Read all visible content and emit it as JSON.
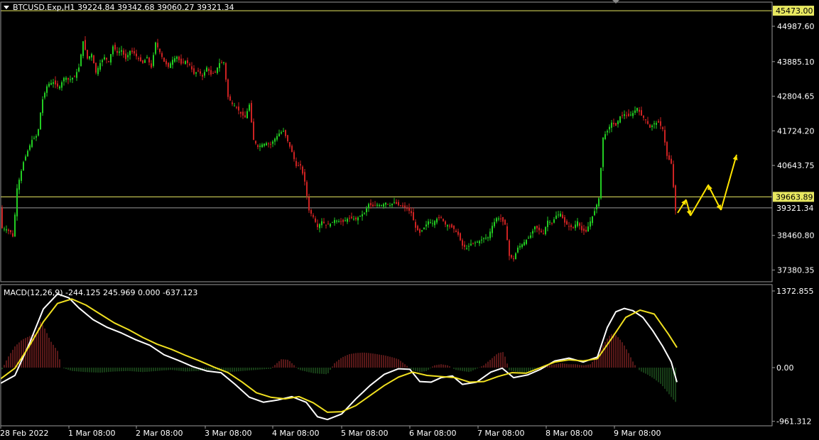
{
  "header": {
    "symbol_line": "BTCUSD.Exp,H1  39224.84 39342.68 39060.27 39321.34",
    "macd_line": "MACD(12,26,9) -244.125 245.969 0.000 -637.123"
  },
  "colors": {
    "background": "#000000",
    "bull": "#22cc22",
    "bear": "#cc2222",
    "hline": "#e8e860",
    "price_line": "#9a9a9a",
    "macd_main": "#ffffff",
    "macd_signal": "#f0e020",
    "hist_pos": "#b03030",
    "hist_neg": "#2e7a2e",
    "arrow": "#ffe400",
    "grid_border": "#9a9a9a"
  },
  "chart_data": [
    {
      "type": "candlestick",
      "title": "BTCUSD.Exp,H1",
      "price_axis_ticks": [
        "44987.60",
        "43885.10",
        "42804.65",
        "41724.20",
        "40643.75",
        "39663.89",
        "38460.80",
        "37380.35"
      ],
      "price_axis_values": [
        44987.6,
        43885.1,
        42804.65,
        41724.2,
        40643.75,
        39663.89,
        38460.8,
        37380.35
      ],
      "ylim": [
        37060,
        45600
      ],
      "time_axis_labels": [
        "28 Feb 2022",
        "1 Mar 08:00",
        "2 Mar 08:00",
        "3 Mar 08:00",
        "4 Mar 08:00",
        "5 Mar 08:00",
        "6 Mar 08:00",
        "7 Mar 08:00",
        "8 Mar 08:00",
        "9 Mar 08:00"
      ],
      "last_ohlc": {
        "open": 39224.84,
        "high": 39342.68,
        "low": 39060.27,
        "close": 39321.34
      },
      "horizontal_lines": [
        {
          "value": 45473.0,
          "label": "45473.00"
        },
        {
          "value": 39663.89,
          "label": "39663.89"
        }
      ],
      "current_price": {
        "value": 39321.34,
        "label": "39321.34"
      },
      "close_path": [
        [
          0,
          38700
        ],
        [
          8,
          38650
        ],
        [
          14,
          38560
        ],
        [
          18,
          38380
        ],
        [
          22,
          39840
        ],
        [
          28,
          40380
        ],
        [
          32,
          40750
        ],
        [
          38,
          41100
        ],
        [
          44,
          41440
        ],
        [
          52,
          41600
        ],
        [
          58,
          42640
        ],
        [
          66,
          43180
        ],
        [
          74,
          43240
        ],
        [
          82,
          43060
        ],
        [
          90,
          43420
        ],
        [
          96,
          43300
        ],
        [
          104,
          43420
        ],
        [
          110,
          43700
        ],
        [
          116,
          44520
        ],
        [
          122,
          43980
        ],
        [
          128,
          44120
        ],
        [
          134,
          43540
        ],
        [
          140,
          43840
        ],
        [
          146,
          44020
        ],
        [
          152,
          43880
        ],
        [
          158,
          44360
        ],
        [
          164,
          44160
        ],
        [
          170,
          44240
        ],
        [
          176,
          43960
        ],
        [
          182,
          44220
        ],
        [
          188,
          44140
        ],
        [
          194,
          43960
        ],
        [
          200,
          43840
        ],
        [
          206,
          44020
        ],
        [
          212,
          43700
        ],
        [
          218,
          44480
        ],
        [
          224,
          44180
        ],
        [
          230,
          43880
        ],
        [
          236,
          43720
        ],
        [
          242,
          43940
        ],
        [
          248,
          44040
        ],
        [
          254,
          43820
        ],
        [
          260,
          43900
        ],
        [
          266,
          43780
        ],
        [
          272,
          43500
        ],
        [
          278,
          43600
        ],
        [
          284,
          43420
        ],
        [
          290,
          43700
        ],
        [
          296,
          43480
        ],
        [
          302,
          43560
        ],
        [
          308,
          43840
        ],
        [
          314,
          43860
        ],
        [
          320,
          42780
        ],
        [
          326,
          42560
        ],
        [
          332,
          42460
        ],
        [
          338,
          42260
        ],
        [
          344,
          42140
        ],
        [
          350,
          42540
        ],
        [
          356,
          41440
        ],
        [
          362,
          41220
        ],
        [
          368,
          41300
        ],
        [
          374,
          41340
        ],
        [
          380,
          41300
        ],
        [
          386,
          41480
        ],
        [
          392,
          41640
        ],
        [
          398,
          41720
        ],
        [
          404,
          41400
        ],
        [
          410,
          41060
        ],
        [
          416,
          40620
        ],
        [
          422,
          40640
        ],
        [
          428,
          40140
        ],
        [
          434,
          39240
        ],
        [
          440,
          39040
        ],
        [
          446,
          38720
        ],
        [
          452,
          38900
        ],
        [
          458,
          38780
        ],
        [
          464,
          38820
        ],
        [
          470,
          38940
        ],
        [
          476,
          38900
        ],
        [
          482,
          38880
        ],
        [
          488,
          38980
        ],
        [
          494,
          39000
        ],
        [
          500,
          38960
        ],
        [
          506,
          39080
        ],
        [
          512,
          39160
        ],
        [
          518,
          39440
        ],
        [
          524,
          39360
        ],
        [
          530,
          39420
        ],
        [
          536,
          39400
        ],
        [
          542,
          39480
        ],
        [
          548,
          39400
        ],
        [
          554,
          39500
        ],
        [
          560,
          39400
        ],
        [
          566,
          39360
        ],
        [
          572,
          39300
        ],
        [
          578,
          39160
        ],
        [
          584,
          38700
        ],
        [
          590,
          38540
        ],
        [
          596,
          38700
        ],
        [
          602,
          38900
        ],
        [
          608,
          38840
        ],
        [
          614,
          38980
        ],
        [
          620,
          39020
        ],
        [
          626,
          38800
        ],
        [
          632,
          38760
        ],
        [
          638,
          38660
        ],
        [
          644,
          38480
        ],
        [
          650,
          38140
        ],
        [
          656,
          38060
        ],
        [
          662,
          38200
        ],
        [
          668,
          38240
        ],
        [
          674,
          38280
        ],
        [
          680,
          38380
        ],
        [
          686,
          38400
        ],
        [
          692,
          38760
        ],
        [
          698,
          39000
        ],
        [
          704,
          38980
        ],
        [
          710,
          38800
        ],
        [
          716,
          37820
        ],
        [
          722,
          37720
        ],
        [
          728,
          38080
        ],
        [
          734,
          38180
        ],
        [
          740,
          38320
        ],
        [
          746,
          38460
        ],
        [
          752,
          38740
        ],
        [
          758,
          38620
        ],
        [
          764,
          38520
        ],
        [
          770,
          38920
        ],
        [
          776,
          38840
        ],
        [
          782,
          39080
        ],
        [
          788,
          39140
        ],
        [
          794,
          38860
        ],
        [
          800,
          38740
        ],
        [
          806,
          38700
        ],
        [
          812,
          38900
        ],
        [
          818,
          38620
        ],
        [
          824,
          38580
        ],
        [
          830,
          38900
        ],
        [
          836,
          39220
        ],
        [
          842,
          39620
        ],
        [
          848,
          41520
        ],
        [
          854,
          41720
        ],
        [
          860,
          41980
        ],
        [
          866,
          41880
        ],
        [
          872,
          42180
        ],
        [
          878,
          42240
        ],
        [
          884,
          42180
        ],
        [
          890,
          42280
        ],
        [
          896,
          42440
        ],
        [
          902,
          42200
        ],
        [
          908,
          42060
        ],
        [
          914,
          41820
        ],
        [
          920,
          41960
        ],
        [
          926,
          41980
        ],
        [
          932,
          41780
        ],
        [
          938,
          40940
        ],
        [
          944,
          40700
        ],
        [
          950,
          39240
        ],
        [
          952,
          39321
        ]
      ]
    },
    {
      "type": "line",
      "title": "MACD(12,26,9)",
      "ylim": [
        -1030,
        1430
      ],
      "ticks": [
        "1372.855",
        "0.00",
        "-961.312"
      ],
      "tick_values": [
        1372.855,
        0.0,
        -961.312
      ],
      "main_value": -244.125,
      "signal_value": 245.969,
      "main": [
        [
          0,
          -280
        ],
        [
          20,
          -140
        ],
        [
          40,
          420
        ],
        [
          60,
          1050
        ],
        [
          80,
          1320
        ],
        [
          96,
          1250
        ],
        [
          110,
          1070
        ],
        [
          130,
          860
        ],
        [
          150,
          720
        ],
        [
          170,
          620
        ],
        [
          190,
          500
        ],
        [
          210,
          400
        ],
        [
          230,
          230
        ],
        [
          250,
          130
        ],
        [
          270,
          20
        ],
        [
          290,
          -60
        ],
        [
          310,
          -90
        ],
        [
          330,
          -300
        ],
        [
          350,
          -530
        ],
        [
          370,
          -620
        ],
        [
          390,
          -580
        ],
        [
          410,
          -520
        ],
        [
          430,
          -620
        ],
        [
          446,
          -880
        ],
        [
          460,
          -930
        ],
        [
          480,
          -830
        ],
        [
          500,
          -560
        ],
        [
          520,
          -320
        ],
        [
          540,
          -120
        ],
        [
          560,
          -20
        ],
        [
          576,
          -30
        ],
        [
          590,
          -250
        ],
        [
          606,
          -260
        ],
        [
          620,
          -180
        ],
        [
          636,
          -150
        ],
        [
          650,
          -300
        ],
        [
          670,
          -260
        ],
        [
          690,
          -80
        ],
        [
          706,
          -10
        ],
        [
          722,
          -180
        ],
        [
          742,
          -130
        ],
        [
          760,
          -30
        ],
        [
          780,
          120
        ],
        [
          800,
          170
        ],
        [
          820,
          100
        ],
        [
          840,
          190
        ],
        [
          854,
          720
        ],
        [
          866,
          1000
        ],
        [
          878,
          1060
        ],
        [
          890,
          1020
        ],
        [
          904,
          900
        ],
        [
          918,
          660
        ],
        [
          932,
          380
        ],
        [
          944,
          100
        ],
        [
          952,
          -260
        ]
      ],
      "signal": [
        [
          0,
          -200
        ],
        [
          20,
          -10
        ],
        [
          40,
          380
        ],
        [
          60,
          820
        ],
        [
          80,
          1150
        ],
        [
          100,
          1230
        ],
        [
          120,
          1120
        ],
        [
          140,
          960
        ],
        [
          160,
          800
        ],
        [
          180,
          680
        ],
        [
          200,
          540
        ],
        [
          220,
          420
        ],
        [
          240,
          330
        ],
        [
          260,
          220
        ],
        [
          280,
          120
        ],
        [
          300,
          10
        ],
        [
          320,
          -90
        ],
        [
          340,
          -260
        ],
        [
          360,
          -450
        ],
        [
          380,
          -530
        ],
        [
          400,
          -560
        ],
        [
          420,
          -520
        ],
        [
          440,
          -630
        ],
        [
          460,
          -800
        ],
        [
          480,
          -790
        ],
        [
          500,
          -680
        ],
        [
          520,
          -500
        ],
        [
          540,
          -320
        ],
        [
          560,
          -170
        ],
        [
          580,
          -80
        ],
        [
          600,
          -140
        ],
        [
          620,
          -160
        ],
        [
          640,
          -180
        ],
        [
          660,
          -260
        ],
        [
          680,
          -250
        ],
        [
          700,
          -160
        ],
        [
          720,
          -90
        ],
        [
          740,
          -100
        ],
        [
          760,
          0
        ],
        [
          780,
          100
        ],
        [
          800,
          140
        ],
        [
          820,
          120
        ],
        [
          840,
          160
        ],
        [
          860,
          520
        ],
        [
          880,
          900
        ],
        [
          900,
          1030
        ],
        [
          920,
          960
        ],
        [
          940,
          600
        ],
        [
          952,
          360
        ]
      ],
      "histogram": [
        [
          0,
          -80
        ],
        [
          10,
          180
        ],
        [
          20,
          380
        ],
        [
          30,
          500
        ],
        [
          40,
          560
        ],
        [
          50,
          620
        ],
        [
          56,
          820
        ],
        [
          62,
          700
        ],
        [
          70,
          480
        ],
        [
          80,
          300
        ],
        [
          86,
          0
        ],
        [
          100,
          -60
        ],
        [
          120,
          -80
        ],
        [
          140,
          -90
        ],
        [
          160,
          -70
        ],
        [
          180,
          -60
        ],
        [
          200,
          -80
        ],
        [
          220,
          -60
        ],
        [
          240,
          -40
        ],
        [
          260,
          -70
        ],
        [
          280,
          -60
        ],
        [
          300,
          -40
        ],
        [
          320,
          -80
        ],
        [
          340,
          -60
        ],
        [
          360,
          -40
        ],
        [
          380,
          -20
        ],
        [
          395,
          150
        ],
        [
          405,
          140
        ],
        [
          420,
          -40
        ],
        [
          440,
          -100
        ],
        [
          460,
          -120
        ],
        [
          470,
          80
        ],
        [
          480,
          180
        ],
        [
          490,
          240
        ],
        [
          500,
          260
        ],
        [
          510,
          270
        ],
        [
          520,
          260
        ],
        [
          530,
          240
        ],
        [
          540,
          220
        ],
        [
          550,
          190
        ],
        [
          560,
          150
        ],
        [
          570,
          50
        ],
        [
          580,
          -50
        ],
        [
          590,
          -80
        ],
        [
          600,
          -60
        ],
        [
          610,
          40
        ],
        [
          620,
          60
        ],
        [
          630,
          40
        ],
        [
          640,
          -40
        ],
        [
          660,
          -80
        ],
        [
          680,
          40
        ],
        [
          690,
          150
        ],
        [
          700,
          260
        ],
        [
          708,
          280
        ],
        [
          716,
          -50
        ],
        [
          730,
          -80
        ],
        [
          740,
          -90
        ],
        [
          750,
          -40
        ],
        [
          760,
          -20
        ],
        [
          770,
          40
        ],
        [
          780,
          60
        ],
        [
          790,
          80
        ],
        [
          800,
          60
        ],
        [
          810,
          60
        ],
        [
          820,
          40
        ],
        [
          830,
          60
        ],
        [
          840,
          200
        ],
        [
          848,
          400
        ],
        [
          856,
          560
        ],
        [
          862,
          620
        ],
        [
          868,
          560
        ],
        [
          876,
          440
        ],
        [
          884,
          260
        ],
        [
          892,
          60
        ],
        [
          900,
          -60
        ],
        [
          910,
          -120
        ],
        [
          920,
          -200
        ],
        [
          930,
          -300
        ],
        [
          940,
          -460
        ],
        [
          946,
          -560
        ],
        [
          952,
          -640
        ]
      ]
    }
  ]
}
